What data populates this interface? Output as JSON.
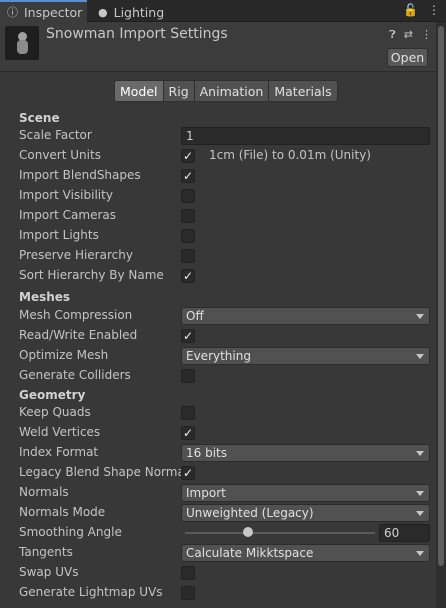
{
  "tabs": [
    {
      "label": "Inspector",
      "icon": "info-icon",
      "active": true
    },
    {
      "label": "Lighting",
      "icon": "bulb-icon",
      "active": false
    }
  ],
  "header": {
    "title": "Snowman Import Settings",
    "open_label": "Open"
  },
  "subtabs": [
    "Model",
    "Rig",
    "Animation",
    "Materials"
  ],
  "sections": {
    "scene": "Scene",
    "meshes": "Meshes",
    "geometry": "Geometry"
  },
  "fields": {
    "scale_factor": {
      "label": "Scale Factor",
      "value": "1"
    },
    "convert_units": {
      "label": "Convert Units",
      "checked": true,
      "note": "1cm (File) to 0.01m (Unity)"
    },
    "import_blendshapes": {
      "label": "Import BlendShapes",
      "checked": true
    },
    "import_visibility": {
      "label": "Import Visibility",
      "checked": false
    },
    "import_cameras": {
      "label": "Import Cameras",
      "checked": false
    },
    "import_lights": {
      "label": "Import Lights",
      "checked": false
    },
    "preserve_hierarchy": {
      "label": "Preserve Hierarchy",
      "checked": false
    },
    "sort_hierarchy": {
      "label": "Sort Hierarchy By Name",
      "checked": true
    },
    "mesh_compression": {
      "label": "Mesh Compression",
      "value": "Off"
    },
    "read_write": {
      "label": "Read/Write Enabled",
      "checked": true
    },
    "optimize_mesh": {
      "label": "Optimize Mesh",
      "value": "Everything"
    },
    "generate_colliders": {
      "label": "Generate Colliders",
      "checked": false
    },
    "keep_quads": {
      "label": "Keep Quads",
      "checked": false
    },
    "weld_vertices": {
      "label": "Weld Vertices",
      "checked": true
    },
    "index_format": {
      "label": "Index Format",
      "value": "16 bits"
    },
    "legacy_blend": {
      "label": "Legacy Blend Shape Normals",
      "checked": true
    },
    "normals": {
      "label": "Normals",
      "value": "Import"
    },
    "normals_mode": {
      "label": "Normals Mode",
      "value": "Unweighted (Legacy)"
    },
    "smoothing_angle": {
      "label": "Smoothing Angle",
      "value": "60",
      "fraction": 0.333
    },
    "tangents": {
      "label": "Tangents",
      "value": "Calculate Mikktspace"
    },
    "swap_uvs": {
      "label": "Swap UVs",
      "checked": false
    },
    "generate_lightmap_uvs": {
      "label": "Generate Lightmap UVs",
      "checked": false
    }
  }
}
